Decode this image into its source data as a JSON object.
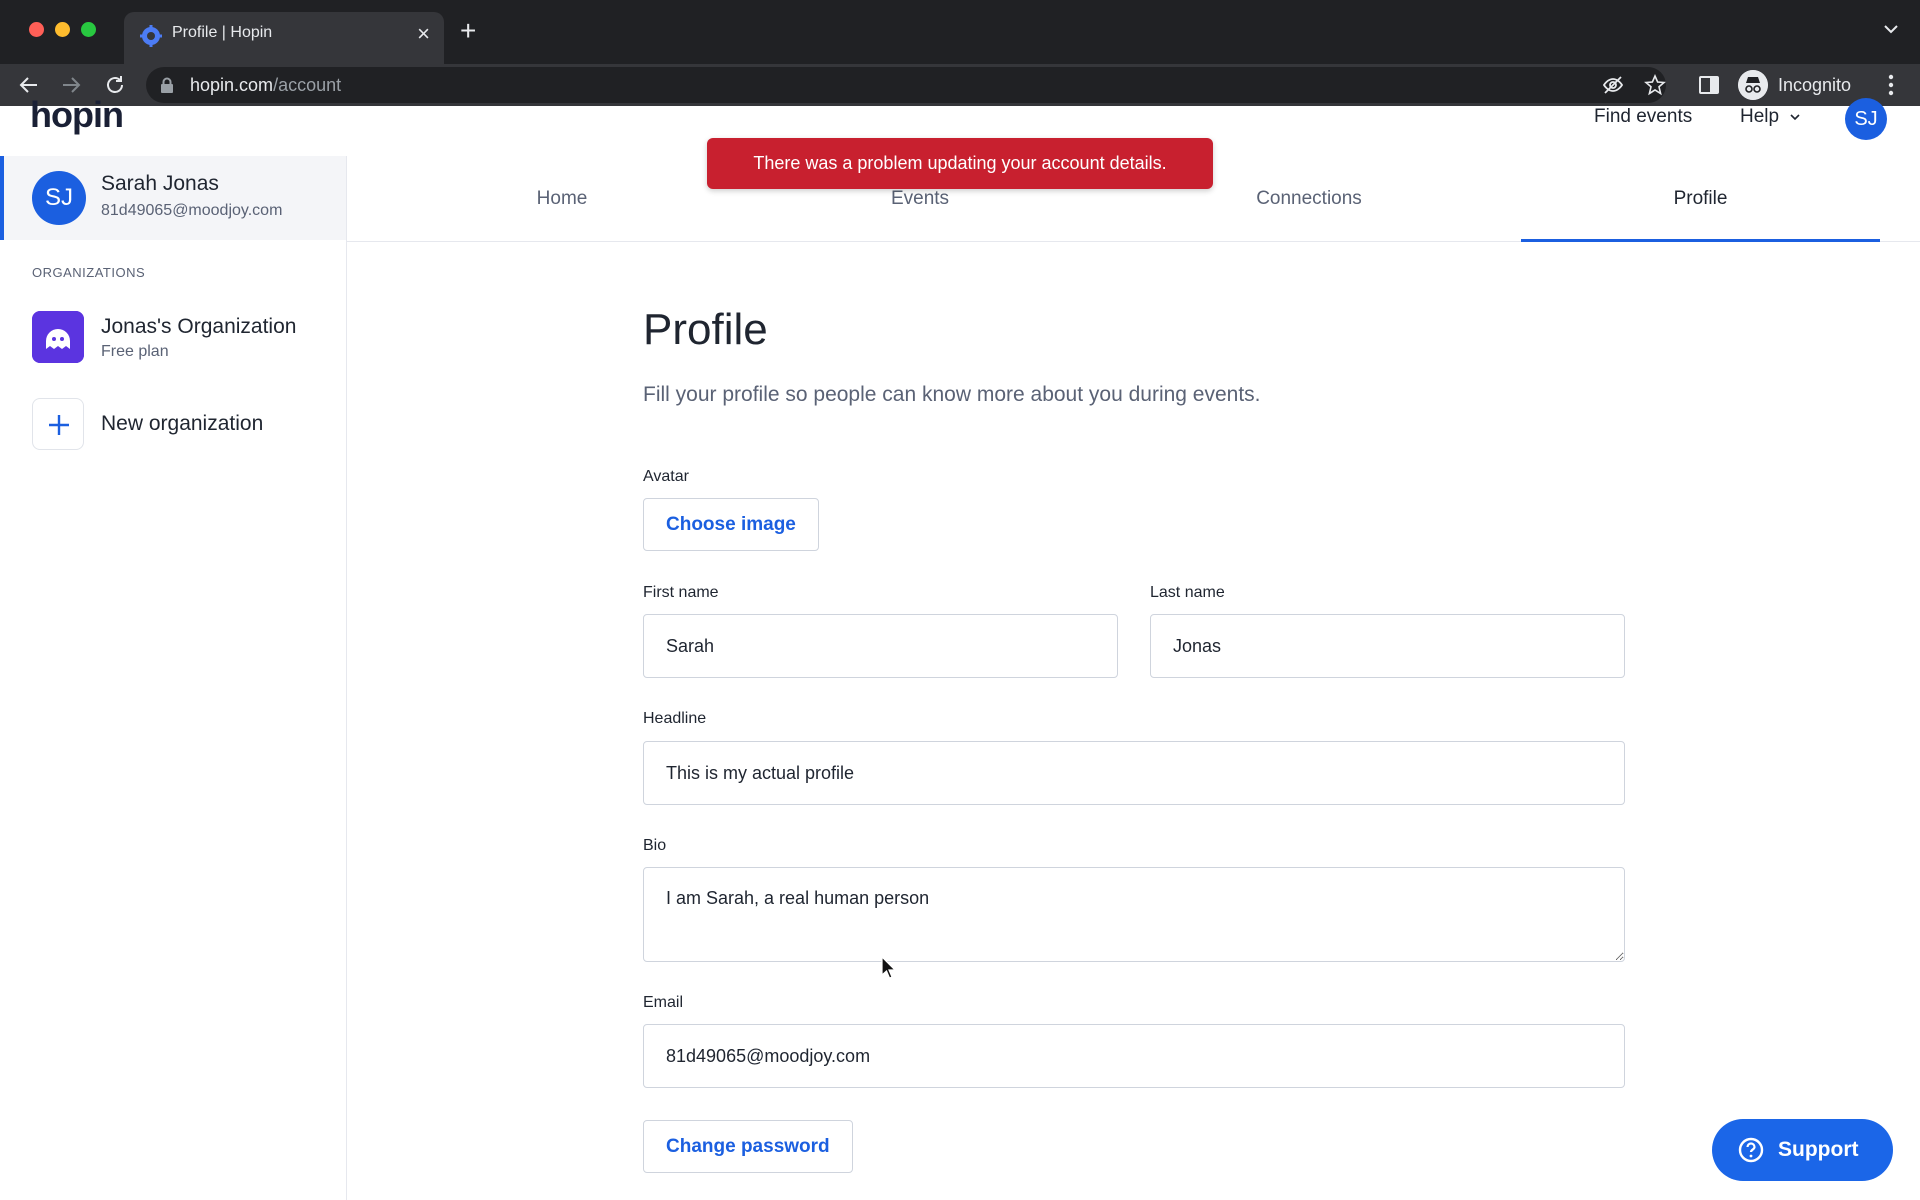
{
  "browser": {
    "tab_title": "Profile | Hopin",
    "url_host": "hopin.com",
    "url_path": "/account",
    "incognito_label": "Incognito"
  },
  "header": {
    "logo_text": "hopin",
    "find_events": "Find events",
    "help": "Help",
    "avatar_initials": "SJ"
  },
  "toast": {
    "message": "There was a problem updating your account details."
  },
  "sidebar": {
    "user": {
      "initials": "SJ",
      "name": "Sarah Jonas",
      "email": "81d49065@moodjoy.com"
    },
    "organizations_heading": "ORGANIZATIONS",
    "organizations": [
      {
        "name": "Jonas's Organization",
        "plan": "Free plan"
      }
    ],
    "new_org_label": "New organization"
  },
  "tabs": [
    {
      "label": "Home"
    },
    {
      "label": "Events"
    },
    {
      "label": "Connections"
    },
    {
      "label": "Profile"
    }
  ],
  "profile": {
    "title": "Profile",
    "subtitle": "Fill your profile so people can know more about you during events.",
    "avatar_label": "Avatar",
    "choose_image": "Choose image",
    "first_name_label": "First name",
    "first_name": "Sarah",
    "last_name_label": "Last name",
    "last_name": "Jonas",
    "headline_label": "Headline",
    "headline": "This is my actual profile",
    "bio_label": "Bio",
    "bio": "I am Sarah, a real human person",
    "email_label": "Email",
    "email": "81d49065@moodjoy.com",
    "change_password": "Change password"
  },
  "support": {
    "label": "Support"
  },
  "colors": {
    "brand_blue": "#1b5fe0",
    "error_red": "#c8202f"
  }
}
